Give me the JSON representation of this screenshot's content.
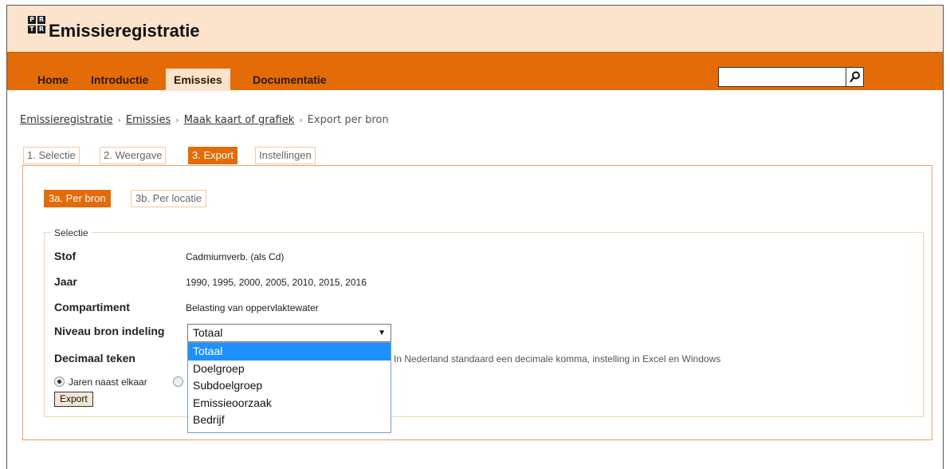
{
  "header": {
    "logo_letters": [
      "P",
      "R",
      "T",
      "R"
    ],
    "site_title": "Emissieregistratie"
  },
  "nav": {
    "items": [
      {
        "label": "Home",
        "active": false
      },
      {
        "label": "Introductie",
        "active": false
      },
      {
        "label": "Emissies",
        "active": true
      },
      {
        "label": "Documentatie",
        "active": false
      }
    ],
    "search": {
      "value": "",
      "placeholder": "",
      "icon": "search-icon"
    }
  },
  "breadcrumb": {
    "items": [
      {
        "label": "Emissieregistratie",
        "link": true
      },
      {
        "label": "Emissies",
        "link": true
      },
      {
        "label": "Maak kaart of grafiek",
        "link": true
      },
      {
        "label": "Export per bron",
        "link": false
      }
    ],
    "separator": "›"
  },
  "tabs": [
    {
      "label": "1. Selectie",
      "active": false
    },
    {
      "label": "2. Weergave",
      "active": false
    },
    {
      "label": "3. Export",
      "active": true
    },
    {
      "label": "Instellingen",
      "active": false
    }
  ],
  "subtabs": [
    {
      "label": "3a. Per bron",
      "active": true
    },
    {
      "label": "3b. Per locatie",
      "active": false
    }
  ],
  "selection": {
    "legend": "Selectie",
    "rows": [
      {
        "label": "Stof",
        "value": "Cadmiumverb. (als Cd)"
      },
      {
        "label": "Jaar",
        "value": "1990, 1995, 2000, 2005, 2010, 2015, 2016"
      },
      {
        "label": "Compartiment",
        "value": "Belasting van oppervlaktewater"
      }
    ],
    "niveau_label": "Niveau bron indeling",
    "niveau_selected": "Totaal",
    "niveau_options": [
      "Totaal",
      "Doelgroep",
      "Subdoelgroep",
      "Emissieoorzaak",
      "Bedrijf"
    ],
    "decimaal_label": "Decimaal teken",
    "decimaal_hint": "In Nederland standaard een decimale komma, instelling in Excel en Windows",
    "radio_label": "Jaren naast elkaar",
    "export_label": "Export"
  },
  "colors": {
    "accent": "#e36c09",
    "header_bg": "#fbe3cc",
    "dropdown_highlight": "#1e90ff"
  }
}
